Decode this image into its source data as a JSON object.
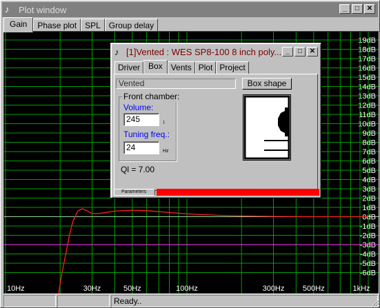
{
  "window": {
    "title": "Plot window",
    "tabs": [
      "Gain",
      "Phase plot",
      "SPL",
      "Group delay"
    ]
  },
  "plot": {
    "y_labels": [
      "19dB",
      "18dB",
      "17dB",
      "16dB",
      "15dB",
      "14dB",
      "13dB",
      "12dB",
      "11dB",
      "10dB",
      "9dB",
      "8dB",
      "7dB",
      "6dB",
      "5dB",
      "4dB",
      "3dB",
      "2dB",
      "1dB",
      "0dB",
      "-1dB",
      "-2dB",
      "-3dB",
      "-4dB",
      "-5dB",
      "-6dB"
    ],
    "x_labels": [
      "10Hz",
      "30Hz",
      "50Hz",
      "100Hz",
      "300Hz",
      "500Hz",
      "1kHz"
    ],
    "colors": {
      "background": "#000000",
      "grid": "#00a000",
      "curve": "#ff2020",
      "reference": "#ff40ff"
    }
  },
  "status": {
    "left": "",
    "middle": "",
    "right": "Ready.."
  },
  "dialog": {
    "title": "[1]Vented : WES SP8-100 8 inch poly...",
    "tabs": [
      "Driver",
      "Box",
      "Vents",
      "Plot",
      "Project"
    ],
    "box_type": "Vented",
    "box_shape_button": "Box shape",
    "front_chamber_label": "Front chamber:",
    "volume_label": "Volume:",
    "volume_value": "245",
    "volume_unit": "l",
    "tuning_label": "Tuning freq.:",
    "tuning_value": "24",
    "tuning_unit": "Hz",
    "ql_text": "Ql = 7.00",
    "parameters_tab": "Parameters"
  }
}
